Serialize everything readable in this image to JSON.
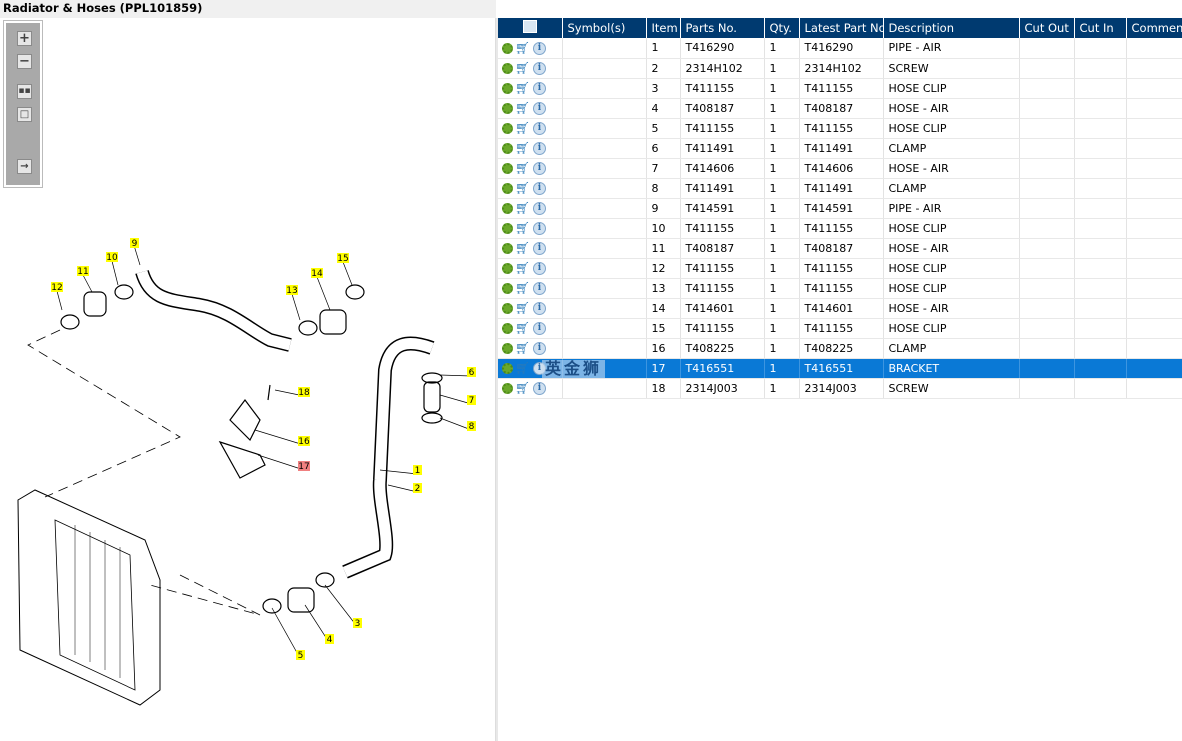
{
  "window": {
    "title": "Radiator & Hoses (PPL101859)"
  },
  "toolbar": {
    "icons": [
      "zoom-in-icon",
      "zoom-out-icon",
      "fit-all-icon",
      "fit-window-icon",
      "export-icon"
    ]
  },
  "table": {
    "columns": [
      "",
      "Symbol(s)",
      "Item",
      "Parts No.",
      "Qty.",
      "Latest Part No.",
      "Description",
      "Cut Out",
      "Cut In",
      "Comment"
    ],
    "selected_item": "17",
    "watermark": "英金狮",
    "rows": [
      {
        "item": "1",
        "part": "T416290",
        "qty": "1",
        "latest": "T416290",
        "desc": "PIPE - AIR"
      },
      {
        "item": "2",
        "part": "2314H102",
        "qty": "1",
        "latest": "2314H102",
        "desc": "SCREW"
      },
      {
        "item": "3",
        "part": "T411155",
        "qty": "1",
        "latest": "T411155",
        "desc": "HOSE CLIP"
      },
      {
        "item": "4",
        "part": "T408187",
        "qty": "1",
        "latest": "T408187",
        "desc": "HOSE - AIR"
      },
      {
        "item": "5",
        "part": "T411155",
        "qty": "1",
        "latest": "T411155",
        "desc": "HOSE CLIP"
      },
      {
        "item": "6",
        "part": "T411491",
        "qty": "1",
        "latest": "T411491",
        "desc": "CLAMP"
      },
      {
        "item": "7",
        "part": "T414606",
        "qty": "1",
        "latest": "T414606",
        "desc": "HOSE - AIR"
      },
      {
        "item": "8",
        "part": "T411491",
        "qty": "1",
        "latest": "T411491",
        "desc": "CLAMP"
      },
      {
        "item": "9",
        "part": "T414591",
        "qty": "1",
        "latest": "T414591",
        "desc": "PIPE - AIR"
      },
      {
        "item": "10",
        "part": "T411155",
        "qty": "1",
        "latest": "T411155",
        "desc": "HOSE CLIP"
      },
      {
        "item": "11",
        "part": "T408187",
        "qty": "1",
        "latest": "T408187",
        "desc": "HOSE - AIR"
      },
      {
        "item": "12",
        "part": "T411155",
        "qty": "1",
        "latest": "T411155",
        "desc": "HOSE CLIP"
      },
      {
        "item": "13",
        "part": "T411155",
        "qty": "1",
        "latest": "T411155",
        "desc": "HOSE CLIP"
      },
      {
        "item": "14",
        "part": "T414601",
        "qty": "1",
        "latest": "T414601",
        "desc": "HOSE - AIR"
      },
      {
        "item": "15",
        "part": "T411155",
        "qty": "1",
        "latest": "T411155",
        "desc": "HOSE CLIP"
      },
      {
        "item": "16",
        "part": "T408225",
        "qty": "1",
        "latest": "T408225",
        "desc": "CLAMP"
      },
      {
        "item": "17",
        "part": "T416551",
        "qty": "1",
        "latest": "T416551",
        "desc": "BRACKET"
      },
      {
        "item": "18",
        "part": "2314J003",
        "qty": "1",
        "latest": "2314J003",
        "desc": "SCREW"
      }
    ]
  },
  "colors": {
    "header": "#003a70",
    "selected": "#0a79d6",
    "callout": "#ffff00",
    "callout_selected": "#f08080"
  },
  "callouts": [
    "1",
    "2",
    "3",
    "4",
    "5",
    "6",
    "7",
    "8",
    "9",
    "10",
    "11",
    "12",
    "13",
    "14",
    "15",
    "16",
    "17",
    "18"
  ]
}
